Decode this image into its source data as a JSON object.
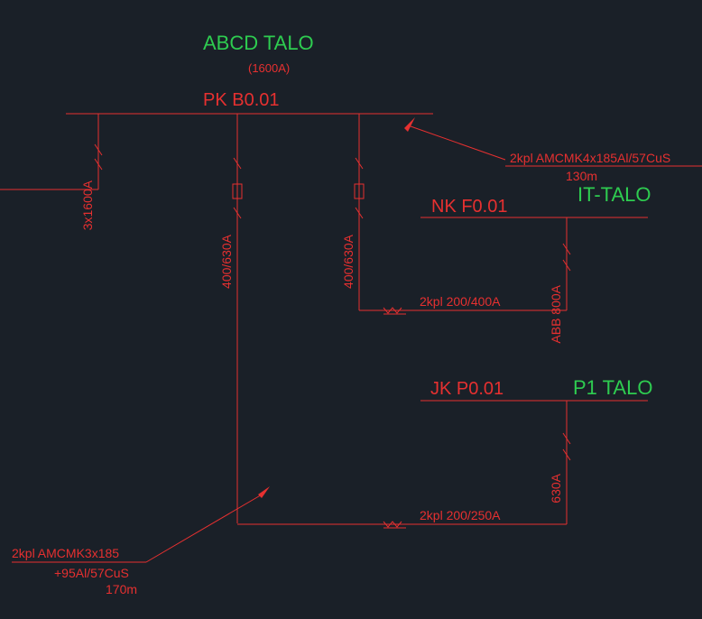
{
  "title": "ABCD TALO",
  "title_rating": "(1600A)",
  "bus1": {
    "label": "PK B0.01",
    "incoming": "3x1600A",
    "feeder1": "400/630A",
    "feeder2": "400/630A"
  },
  "cable1": {
    "spec": "2kpl AMCMK4x185Al/57CuS",
    "length": "130m"
  },
  "bus2": {
    "label": "NK F0.01",
    "location": "IT-TALO",
    "breaker": "ABB 800A"
  },
  "conn1": "2kpl 200/400A",
  "bus3": {
    "label": "JK P0.01",
    "location": "P1 TALO",
    "breaker": "630A"
  },
  "conn2": "2kpl 200/250A",
  "cable2": {
    "spec": "2kpl AMCMK3x185",
    "spec2": "+95Al/57CuS",
    "length": "170m"
  }
}
